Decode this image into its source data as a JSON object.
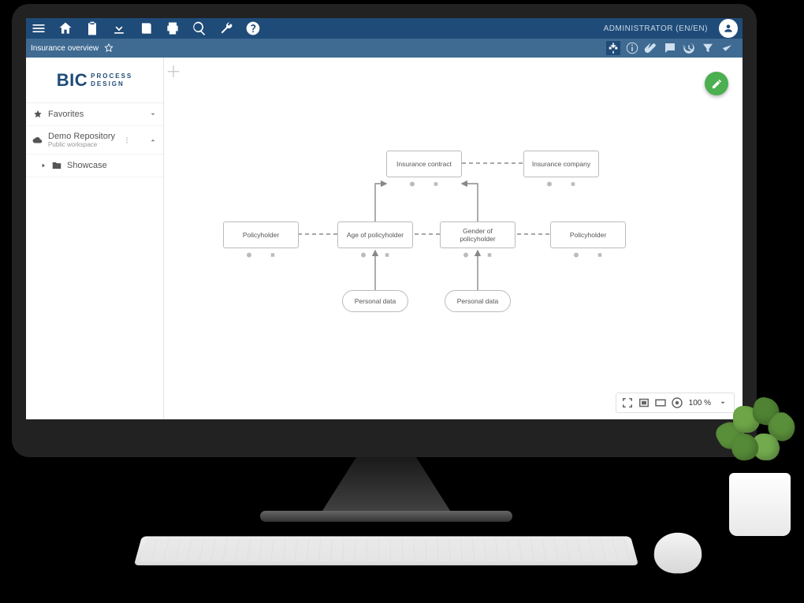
{
  "brand": {
    "main": "BIC",
    "line1": "PROCESS",
    "line2": "DESIGN"
  },
  "user": {
    "name": "ADMINISTRATOR",
    "lang": "(EN/EN)"
  },
  "breadcrumb": {
    "title": "Insurance overview"
  },
  "sidebar": {
    "favorites": "Favorites",
    "repo": "Demo Repository",
    "repo_sub": "Public workspace",
    "showcase": "Showcase"
  },
  "zoom": {
    "level": "100 %"
  },
  "nodes": {
    "ins_contract": "Insurance contract",
    "ins_company": "Insurance company",
    "policyholder_l": "Policyholder",
    "age": "Age of policyholder",
    "gender": "Gender of policyholder",
    "policyholder_r": "Policyholder",
    "personal_l": "Personal data",
    "personal_r": "Personal data"
  }
}
